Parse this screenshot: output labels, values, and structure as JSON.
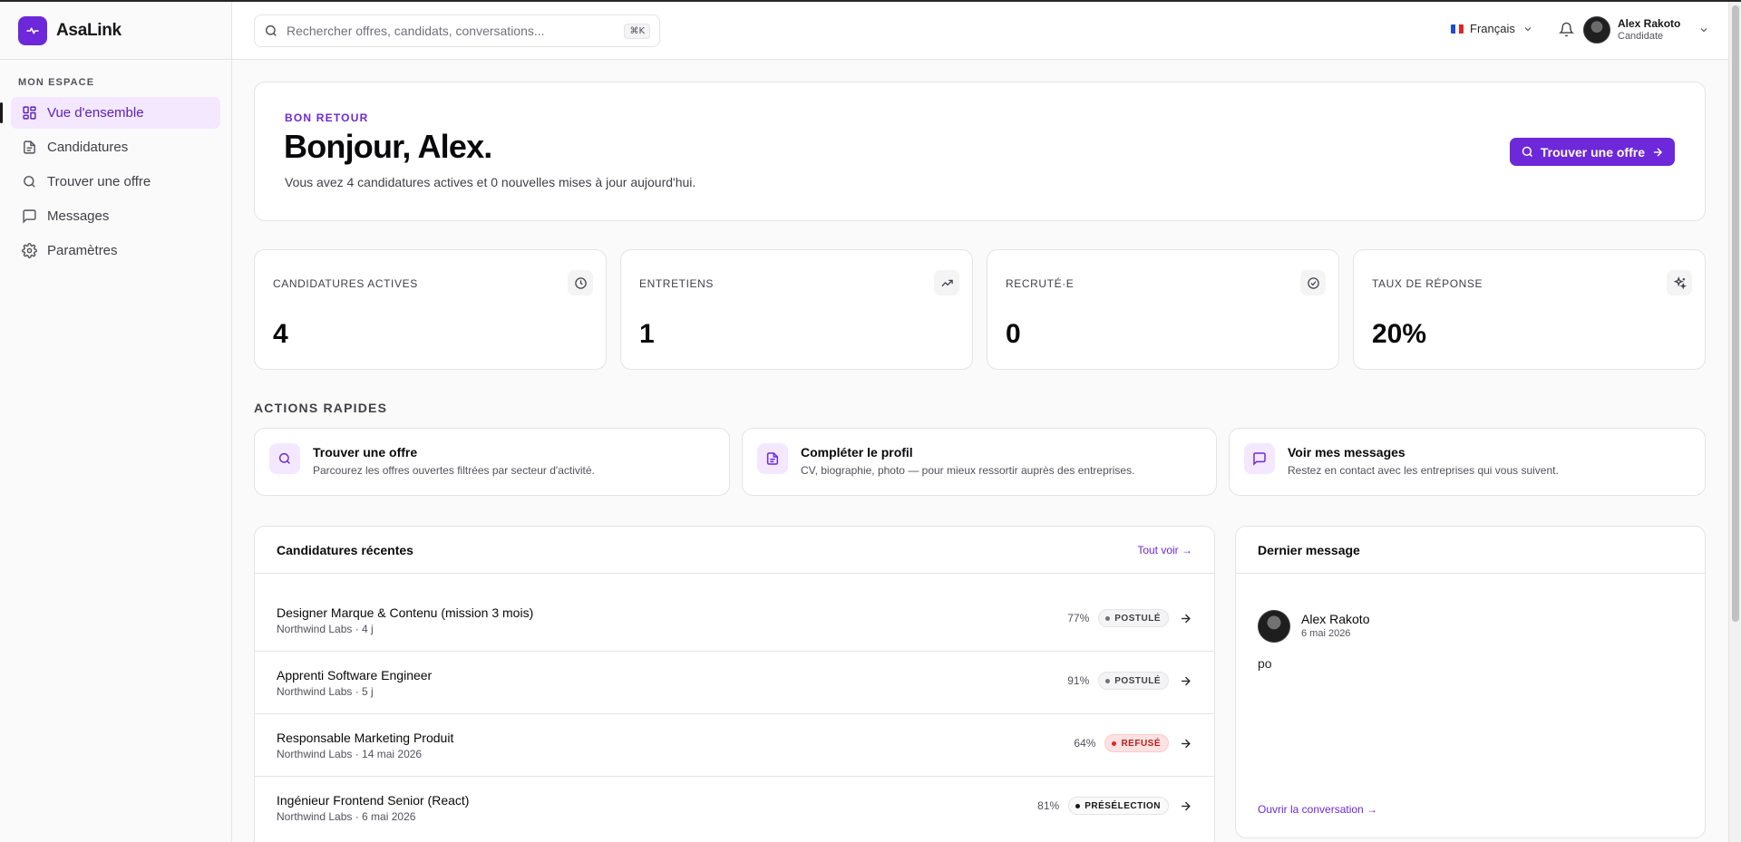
{
  "brand": {
    "name": "AsaLink"
  },
  "sidebar": {
    "section_label": "MON ESPACE",
    "items": [
      {
        "label": "Vue d'ensemble",
        "icon": "grid-icon",
        "active": true
      },
      {
        "label": "Candidatures",
        "icon": "document-icon",
        "active": false
      },
      {
        "label": "Trouver une offre",
        "icon": "search-icon",
        "active": false
      },
      {
        "label": "Messages",
        "icon": "message-icon",
        "active": false
      },
      {
        "label": "Paramètres",
        "icon": "gear-icon",
        "active": false
      }
    ]
  },
  "header": {
    "search": {
      "placeholder": "Rechercher offres, candidats, conversations...",
      "shortcut": "⌘K"
    },
    "language": {
      "label": "Français",
      "flag": "fr-flag-icon"
    },
    "user": {
      "name": "Alex Rakoto",
      "role": "Candidate"
    }
  },
  "hero": {
    "eyebrow": "BON RETOUR",
    "title": "Bonjour, Alex.",
    "subtitle": "Vous avez 4 candidatures actives et 0 nouvelles mises à jour aujourd'hui.",
    "cta": "Trouver une offre"
  },
  "stats": [
    {
      "label": "CANDIDATURES ACTIVES",
      "value": "4",
      "icon": "clock-icon"
    },
    {
      "label": "ENTRETIENS",
      "value": "1",
      "icon": "trending-up-icon"
    },
    {
      "label": "RECRUTÉ·E",
      "value": "0",
      "icon": "check-circle-icon"
    },
    {
      "label": "TAUX DE RÉPONSE",
      "value": "20%",
      "icon": "sparkles-icon"
    }
  ],
  "quick_actions": {
    "title": "ACTIONS RAPIDES",
    "items": [
      {
        "title": "Trouver une offre",
        "desc": "Parcourez les offres ouvertes filtrées par secteur d'activité.",
        "icon": "search-icon"
      },
      {
        "title": "Compléter le profil",
        "desc": "CV, biographie, photo — pour mieux ressortir auprès des entreprises.",
        "icon": "document-icon"
      },
      {
        "title": "Voir mes messages",
        "desc": "Restez en contact avec les entreprises qui vous suivent.",
        "icon": "message-icon"
      }
    ]
  },
  "recent_applications": {
    "title": "Candidatures récentes",
    "see_all": "Tout voir →",
    "rows": [
      {
        "title": "Designer Marque & Contenu (mission 3 mois)",
        "meta": "Northwind Labs · 4 j",
        "pct": "77%",
        "status": "POSTULÉ",
        "status_kind": "applied"
      },
      {
        "title": "Apprenti Software Engineer",
        "meta": "Northwind Labs · 5 j",
        "pct": "91%",
        "status": "POSTULÉ",
        "status_kind": "applied"
      },
      {
        "title": "Responsable Marketing Produit",
        "meta": "Northwind Labs · 14 mai 2026",
        "pct": "64%",
        "status": "REFUSÉ",
        "status_kind": "refused"
      },
      {
        "title": "Ingénieur Frontend Senior (React)",
        "meta": "Northwind Labs · 6 mai 2026",
        "pct": "81%",
        "status": "PRÉSÉLECTION",
        "status_kind": "shortlisted"
      }
    ]
  },
  "last_message": {
    "title": "Dernier message",
    "author": "Alex Rakoto",
    "date": "6 mai 2026",
    "body": "po",
    "open_label": "Ouvrir la conversation →"
  },
  "colors": {
    "accent": "#6d28d9",
    "accent_light": "#f3e8ff",
    "refused": "#dc2626"
  }
}
